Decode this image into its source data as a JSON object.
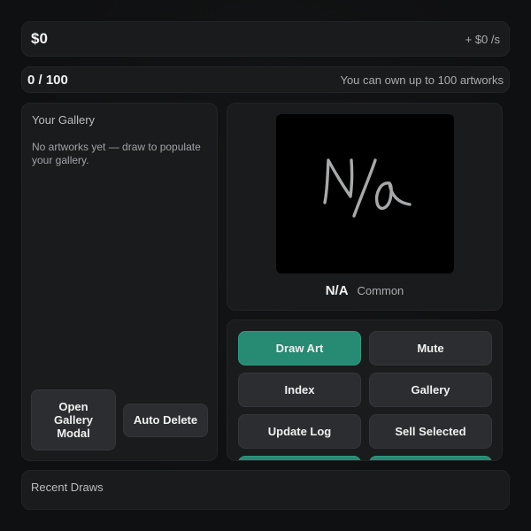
{
  "money": {
    "amount": "$0",
    "rate": "+ $0 /s"
  },
  "capacity": {
    "count": "0 / 100",
    "hint": "You can own up to 100 artworks"
  },
  "gallery": {
    "title": "Your Gallery",
    "empty_message": "No artworks yet — draw to populate your gallery.",
    "open_modal_label": "Open Gallery Modal",
    "auto_delete_label": "Auto Delete"
  },
  "preview": {
    "name": "N/A",
    "rarity": "Common",
    "canvas_background": "#000000",
    "stroke_color": "#a7a9ab"
  },
  "controls": {
    "draw_art": "Draw Art",
    "mute": "Mute",
    "index": "Index",
    "gallery": "Gallery",
    "update_log": "Update Log",
    "sell_selected": "Sell Selected",
    "row4_left": "",
    "row4_right": ""
  },
  "colors": {
    "accent": "#278a73",
    "background": "#101112",
    "panel": "#1a1b1d",
    "button": "#2b2d31"
  },
  "recent": {
    "title": "Recent Draws"
  }
}
